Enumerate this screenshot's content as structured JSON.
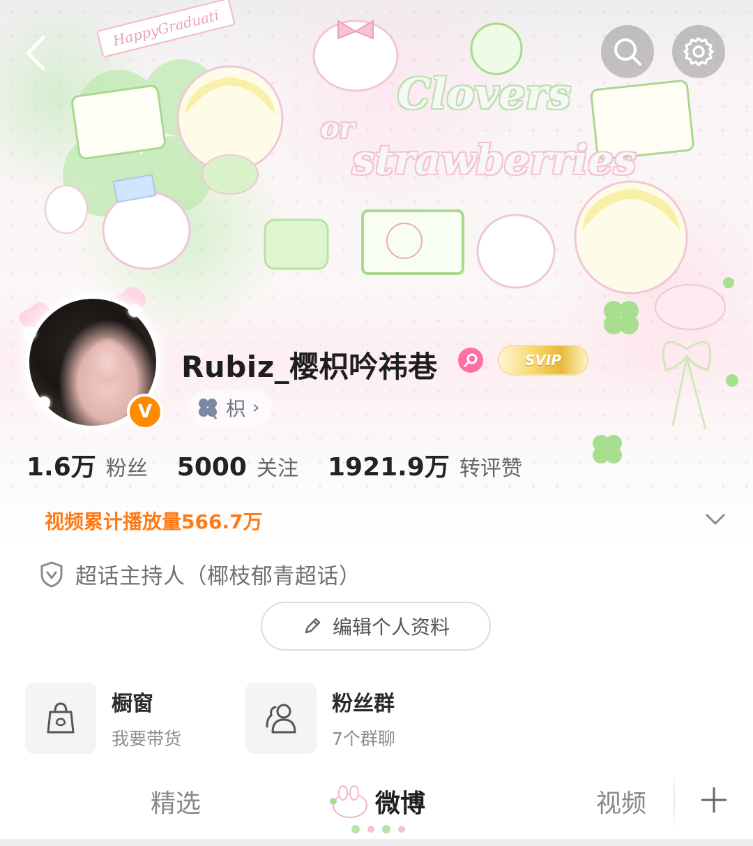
{
  "banner": {
    "ribbon_text": "HappyGraduati",
    "title_line1": "Clovers",
    "title_line2": "or",
    "title_line3": "strawberries"
  },
  "top_bar": {
    "back_icon": "back-arrow-icon",
    "search_icon": "search-icon",
    "settings_icon": "gear-icon"
  },
  "profile": {
    "username": "Rubiz_樱枳吟祎巷",
    "gender": "female",
    "verified_mark": "V",
    "vip_badge": "SVIP",
    "tag_label": "枳",
    "tag_chevron": "›"
  },
  "stats": [
    {
      "value": "1.6万",
      "label": "粉丝"
    },
    {
      "value": "5000",
      "label": "关注"
    },
    {
      "value": "1921.9万",
      "label": "转评赞"
    }
  ],
  "video_play_count": "视频累计播放量566.7万",
  "host_info": "超话主持人（椰枝郁青超话）",
  "edit_profile_label": "编辑个人资料",
  "cards": [
    {
      "title": "橱窗",
      "subtitle": "我要带货",
      "icon": "shopping-bag-icon"
    },
    {
      "title": "粉丝群",
      "subtitle": "7个群聊",
      "icon": "group-icon"
    }
  ],
  "tabs": [
    {
      "label": "精选",
      "active": false
    },
    {
      "label": "微博",
      "active": true
    },
    {
      "label": "视频",
      "active": false
    }
  ],
  "colors": {
    "accent_orange": "#ff7a14",
    "verified_orange": "#ff8a00",
    "gender_pink": "#ff6fa5"
  }
}
